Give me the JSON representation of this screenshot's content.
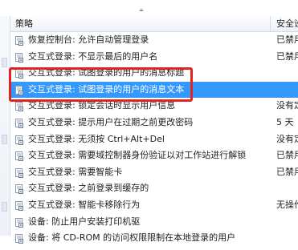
{
  "header": {
    "policy_col": "策略",
    "setting_col": "安全设置"
  },
  "colors": {
    "selected_bg": "#3399ff",
    "highlight_border": "#e0241f"
  },
  "rows": [
    {
      "text": "恢复控制台: 允许自动管理登录",
      "setting": "已禁用"
    },
    {
      "text": "交互式登录: 不显示最后的用户名",
      "setting": "已禁用"
    },
    {
      "text": "交互式登录: 试图登录的用户的消息标题",
      "setting": ""
    },
    {
      "text": "交互式登录: 试图登录的用户的消息文本",
      "setting": ""
    },
    {
      "text": "交互式登录: 锁定会话时显示用户信息",
      "setting": "没有定义"
    },
    {
      "text": "交互式登录: 提示用户在过期之前更改密码",
      "setting": "5 天"
    },
    {
      "text": "交互式登录: 无须按 Ctrl+Alt+Del",
      "setting": "没有定义"
    },
    {
      "text": "交互式登录: 需要域控制器身份验证以对工作站进行解锁",
      "setting": "已禁用"
    },
    {
      "text": "交互式登录: 需要智能卡",
      "setting": "已禁用"
    },
    {
      "text": "交互式登录: 之前登录到缓存的",
      "setting": ""
    },
    {
      "text": "交互式登录: 智能卡移除行为",
      "setting": "无操作"
    },
    {
      "text": "设备: 防止用户安装打印机驱",
      "setting": ""
    },
    {
      "text": "设备: 将 CD-ROM 的访问权限限制在本地登录的用户",
      "setting": ""
    }
  ]
}
